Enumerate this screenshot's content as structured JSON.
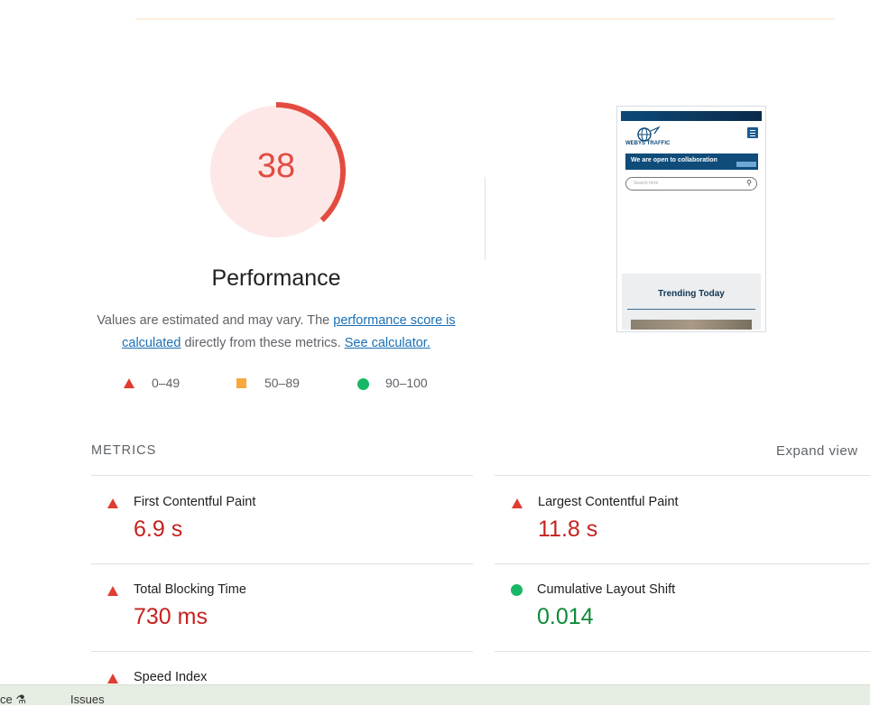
{
  "gauge": {
    "score": "38",
    "score_fraction": 0.38,
    "color": "#e34b41",
    "bg": "#fde8e7"
  },
  "performance": {
    "title": "Performance",
    "desc_part1": "Values are estimated and may vary. The ",
    "link_score": "performance score is calculated",
    "desc_part2": " directly from these metrics. ",
    "link_calculator": "See calculator."
  },
  "legend": [
    {
      "symbol": "triangle-icon",
      "range": "0–49",
      "color": "#e03c31"
    },
    {
      "symbol": "square-icon",
      "range": "50–89",
      "color": "#f6a83c"
    },
    {
      "symbol": "circle-icon",
      "range": "90–100",
      "color": "#18b765"
    }
  ],
  "thumbnail": {
    "logo_text": "WEBYS TRAFFIC",
    "banner_text": "We are open to collaboration",
    "search_placeholder": "Search here",
    "section_title": "Trending Today"
  },
  "metrics": {
    "label": "METRICS",
    "expand": "Expand view",
    "items": [
      {
        "label": "First Contentful Paint",
        "value": "6.9 s",
        "status": "bad"
      },
      {
        "label": "Largest Contentful Paint",
        "value": "11.8 s",
        "status": "bad"
      },
      {
        "label": "Total Blocking Time",
        "value": "730 ms",
        "status": "bad"
      },
      {
        "label": "Cumulative Layout Shift",
        "value": "0.014",
        "status": "good"
      },
      {
        "label": "Speed Index",
        "status": "bad"
      }
    ]
  },
  "bottom_bar": {
    "tab1": "ce",
    "tab1_icon": "flask-icon",
    "tab2": "Issues"
  }
}
